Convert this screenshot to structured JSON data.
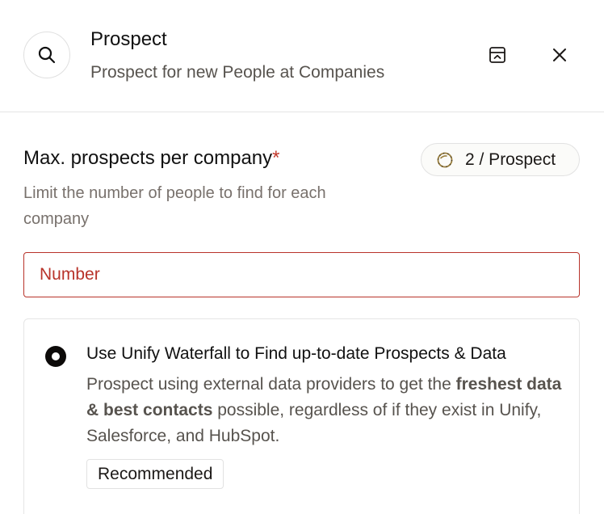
{
  "header": {
    "title": "Prospect",
    "subtitle": "Prospect for new People at Companies",
    "icons": {
      "main": "search-icon",
      "collapse": "collapse-panel-icon",
      "close": "close-icon"
    }
  },
  "field": {
    "label": "Max. prospects per company",
    "required_mark": "*",
    "help": "Limit the number of people to find for each company",
    "input": {
      "placeholder": "Number",
      "value": ""
    },
    "credits": {
      "icon": "coin-icon",
      "text": "2 / Prospect"
    }
  },
  "option": {
    "selected": true,
    "title": "Use Unify Waterfall to Find up-to-date Prospects & Data",
    "desc_part1": "Prospect using external data providers to get the ",
    "desc_bold": "freshest data & best contacts",
    "desc_part2": " possible, regardless of if they exist in Unify, Salesforce, and HubSpot.",
    "badge": "Recommended"
  },
  "colors": {
    "error": "#b8332a",
    "required": "#c2382b",
    "coin": "#a1884a",
    "text_primary": "#111111",
    "text_muted": "#57534e"
  }
}
